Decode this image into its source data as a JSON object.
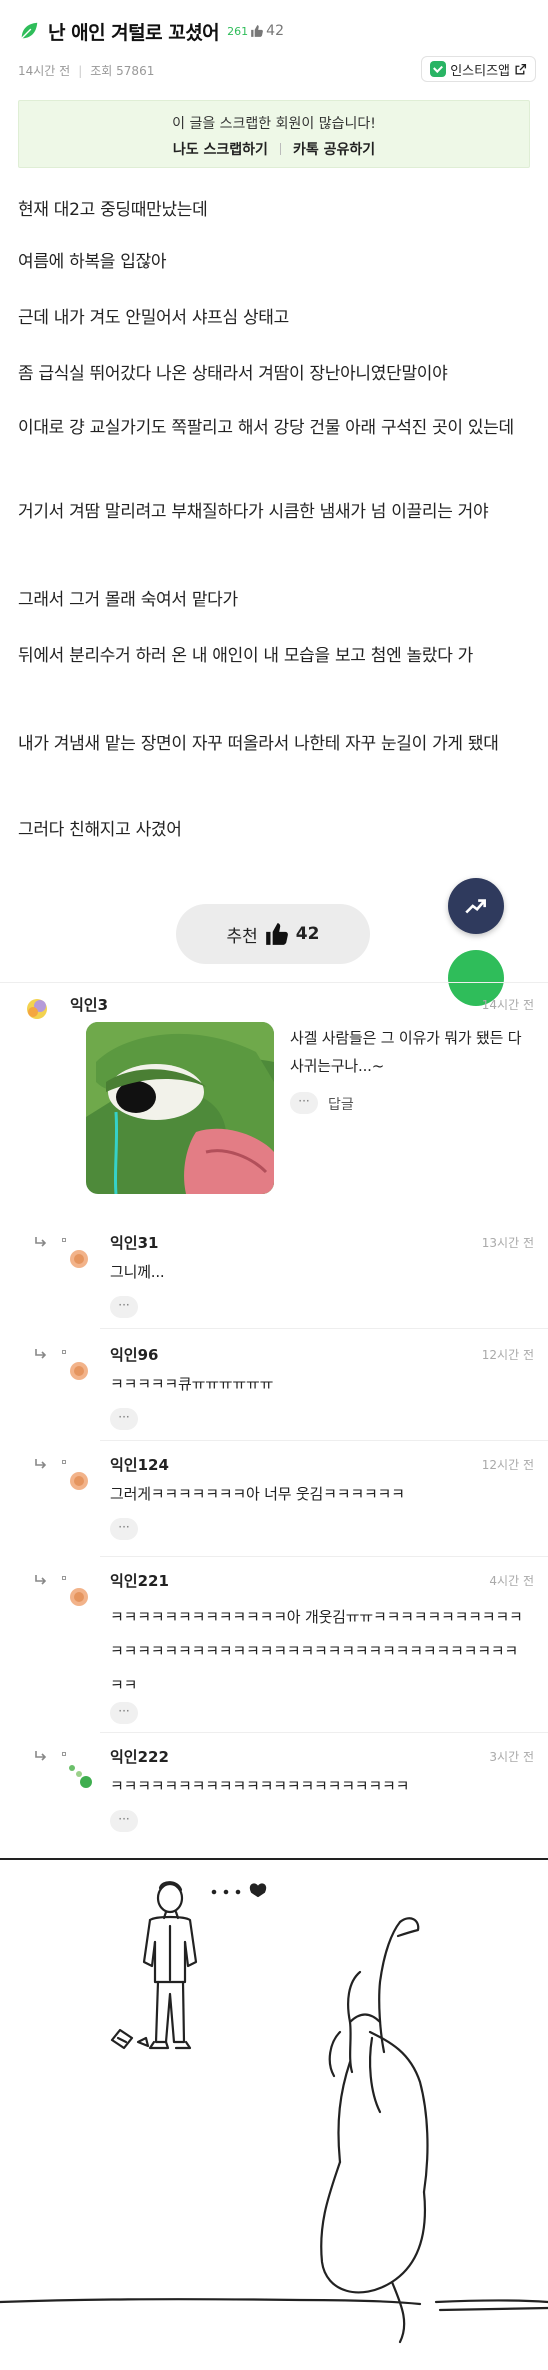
{
  "post": {
    "title": "난 애인 겨털로 꼬셨어",
    "view_badge": "261",
    "like_count": "42",
    "time": "14시간 전",
    "views": "조회 57861",
    "insiz_app_label": "인스티즈앱"
  },
  "scrap": {
    "message": "이 글을 스크랩한 회원이 많습니다!",
    "scrap_action": "나도 스크랩하기",
    "kakao_action": "카톡 공유하기"
  },
  "body": {
    "paragraphs": [
      "현재 대2고 중딩때만났는데",
      "여름에 하복을 입잖아",
      "근데 내가 겨도 안밀어서 샤프심 상태고",
      "좀 급식실 뛰어갔다 나온 상태라서 겨땀이 장난아니였단말이야",
      "이대로 걍 교실가기도 쪽팔리고 해서 강당 건물 아래 구석진 곳이 있는데",
      "거기서 겨땀 말리려고 부채질하다가 시큼한 냄새가 넘 이끌리는 거야",
      "그래서 그거 몰래 숙여서 맡다가",
      "뒤에서 분리수거 하러 온 내 애인이 내 모습을 보고 첨엔 놀랐다 가",
      "내가 겨냄새 맡는 장면이 자꾸 떠올라서 나한테 자꾸 눈길이 가게 됐대",
      "그러다 친해지고 사겼어"
    ]
  },
  "recommend": {
    "label": "추천",
    "count": "42"
  },
  "comments": [
    {
      "name": "익인3",
      "time": "14시간 전",
      "text": "사겔 사람들은 그 이유가 뭐가 됐든 다 사귀는구나...~",
      "reply_label": "답글",
      "more": "···"
    },
    {
      "name": "익인31",
      "time": "13시간 전",
      "text": "그니께...",
      "more": "···"
    },
    {
      "name": "익인96",
      "time": "12시간 전",
      "text": "ㅋㅋㅋㅋㅋ큐ㅠㅠㅠㅠㅠㅠ",
      "more": "···"
    },
    {
      "name": "익인124",
      "time": "12시간 전",
      "text": "그러게ㅋㅋㅋㅋㅋㅋㅋ아 너무 웃김ㅋㅋㅋㅋㅋㅋ",
      "more": "···"
    },
    {
      "name": "익인221",
      "time": "4시간 전",
      "text": "ㅋㅋㅋㅋㅋㅋㅋㅋㅋㅋㅋㅋㅋ아 개웃김ㅠㅠㅋㅋㅋㅋㅋㅋㅋㅋㅋㅋㅋㅋㅋㅋㅋㅋㅋㅋㅋㅋㅋㅋㅋㅋㅋㅋㅋㅋㅋㅋㅋㅋㅋㅋㅋㅋㅋㅋㅋㅋㅋㅋㅋ",
      "more": "···"
    },
    {
      "name": "익인222",
      "time": "3시간 전",
      "text": "ㅋㅋㅋㅋㅋㅋㅋㅋㅋㅋㅋㅋㅋㅋㅋㅋㅋㅋㅋㅋㅋㅋ",
      "more": "···"
    }
  ],
  "icons": {
    "leaf": "leaf-icon",
    "thumb": "thumbs-up-icon",
    "chart": "trending-up-icon",
    "reply": "reply-arrow-icon",
    "external": "external-link-icon"
  },
  "colors": {
    "accent_green": "#2fbd5a",
    "scrap_bg": "#eef8e7",
    "float_navy": "#2f3a5d"
  }
}
